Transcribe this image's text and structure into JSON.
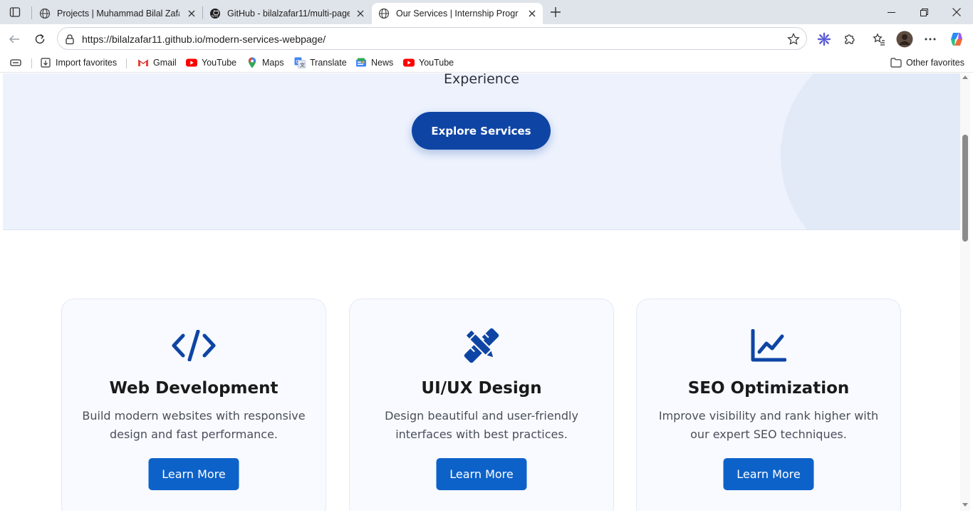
{
  "browser": {
    "tabs": [
      {
        "title": "Projects | Muhammad Bilal Zafar",
        "icon": "globe-icon",
        "active": false
      },
      {
        "title": "GitHub - bilalzafar11/multi-page-",
        "icon": "github-icon",
        "active": false
      },
      {
        "title": "Our Services | Internship Program",
        "icon": "globe-icon",
        "active": true
      }
    ],
    "url": "https://bilalzafar11.github.io/modern-services-webpage/",
    "favorites": [
      {
        "label": "Import favorites",
        "icon": "import-icon"
      },
      {
        "label": "Gmail",
        "icon": "gmail-icon"
      },
      {
        "label": "YouTube",
        "icon": "youtube-icon"
      },
      {
        "label": "Maps",
        "icon": "maps-icon"
      },
      {
        "label": "Translate",
        "icon": "translate-icon"
      },
      {
        "label": "News",
        "icon": "news-icon"
      },
      {
        "label": "YouTube",
        "icon": "youtube-icon"
      }
    ],
    "other_favorites": "Other favorites"
  },
  "hero": {
    "subtitle_tail": "Experience",
    "cta_label": "Explore Services"
  },
  "services": [
    {
      "icon": "code-icon",
      "title": "Web Development",
      "description": "Build modern websites with responsive design and fast performance.",
      "button": "Learn More"
    },
    {
      "icon": "pen-ruler-icon",
      "title": "UI/UX Design",
      "description": "Design beautiful and user-friendly interfaces with best practices.",
      "button": "Learn More"
    },
    {
      "icon": "chart-line-icon",
      "title": "SEO Optimization",
      "description": "Improve visibility and rank higher with our expert SEO techniques.",
      "button": "Learn More"
    }
  ],
  "colors": {
    "primary": "#0e45a5",
    "button": "#0d62c9",
    "hero_bg": "#edf2fd",
    "card_bg": "#f8faff"
  }
}
